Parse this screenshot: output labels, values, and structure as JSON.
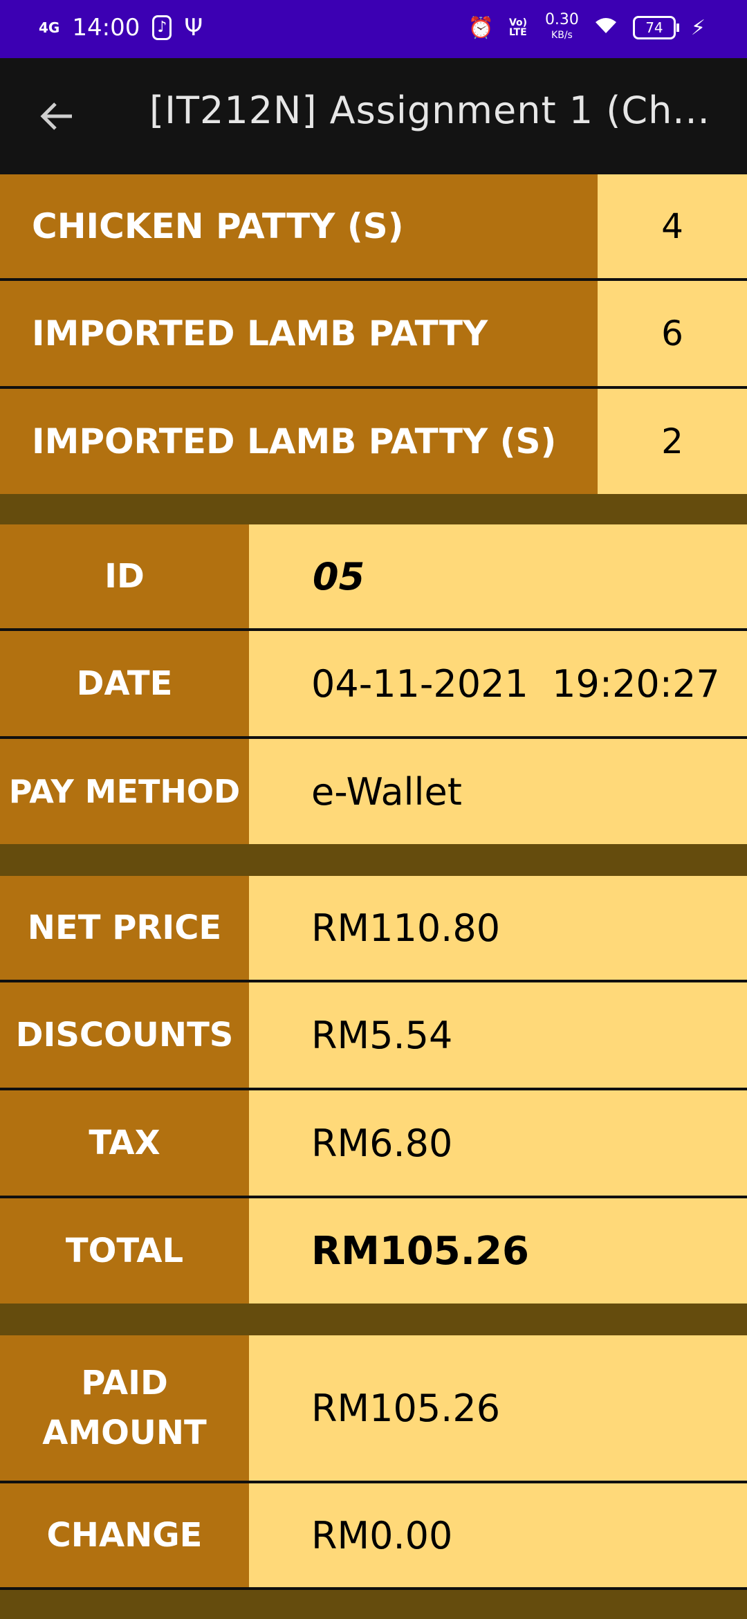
{
  "status_bar": {
    "network": "4G",
    "time": "14:00",
    "speed_value": "0.30",
    "speed_unit": "KB/s",
    "volte": "Vo) LTE",
    "battery": "74"
  },
  "app_bar": {
    "title": "[IT212N] Assignment 1 (Ch..."
  },
  "items": [
    {
      "name": "CHICKEN PATTY (S)",
      "qty": "4"
    },
    {
      "name": "IMPORTED LAMB PATTY",
      "qty": "6"
    },
    {
      "name": "IMPORTED LAMB PATTY (S)",
      "qty": "2"
    }
  ],
  "order": {
    "id_label": "ID",
    "id": "05",
    "date_label": "DATE",
    "date": "04-11-2021  19:20:27",
    "method_label": "PAY METHOD",
    "method": "e-Wallet"
  },
  "pricing": {
    "net_label": "NET PRICE",
    "net": "RM110.80",
    "discount_label": "DISCOUNTS",
    "discount": "RM5.54",
    "tax_label": "TAX",
    "tax": "RM6.80",
    "total_label": "TOTAL",
    "total": "RM105.26"
  },
  "payment": {
    "paid_label_1": "PAID",
    "paid_label_2": "AMOUNT",
    "paid": "RM105.26",
    "change_label": "CHANGE",
    "change": "RM0.00"
  },
  "colors": {
    "status_bar": "#3c00b3",
    "app_bar": "#131313",
    "label_bg": "#b27110",
    "value_bg": "#ffd979",
    "divider": "#654c0d"
  }
}
